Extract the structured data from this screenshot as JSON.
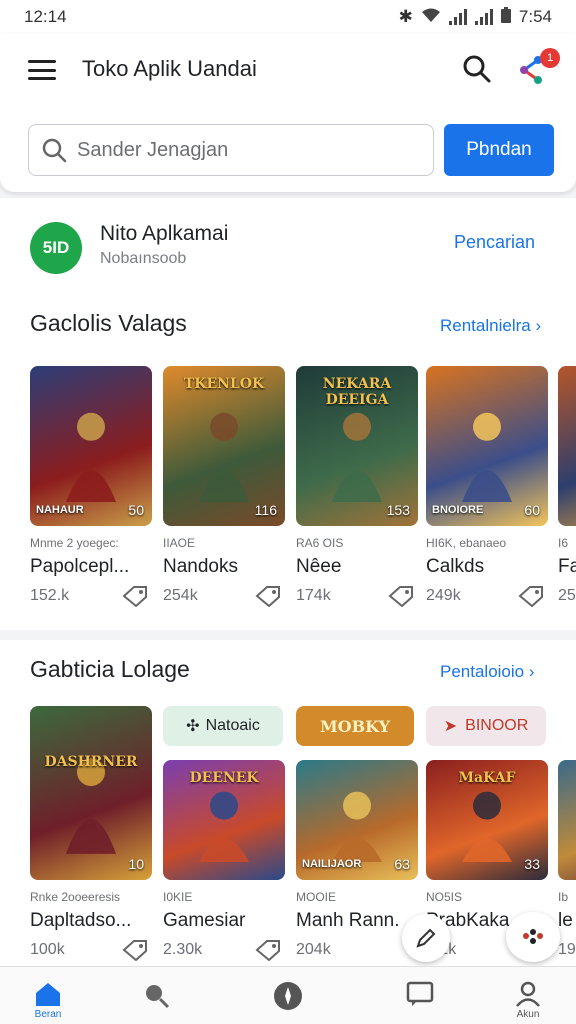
{
  "status_bar": {
    "time": "12:14",
    "right_time": "7:54"
  },
  "header": {
    "title": "Toko Aplik Uandai",
    "notification_count": "1",
    "search_placeholder": "Sander Jenagjan",
    "search_button": "Pbndan"
  },
  "promo": {
    "logo_text": "5ID",
    "title": "Nito Aplkamai",
    "subtitle": "Nobaınsoob",
    "link": "Pencarian"
  },
  "section1": {
    "title": "Gaclolis Valags",
    "link": "Rentalnielra ›",
    "cards": [
      {
        "thumb_label": "NAHAUR",
        "thumb_num": "50",
        "dev": "Mnme 2 yoegec:",
        "name": "Papolcepl...",
        "size": "152.k",
        "colors": [
          "#2c3e78",
          "#8c1d1d",
          "#c9a04a"
        ]
      },
      {
        "thumb_title": "TKENLOK",
        "thumb_num": "116",
        "dev": "IIAOE",
        "name": "Nandoks",
        "size": "254k",
        "colors": [
          "#e08a2c",
          "#3d5a3a",
          "#7a4a2a"
        ]
      },
      {
        "thumb_title": "NEKARA DEEIGA",
        "thumb_num": "153",
        "dev": "RA6 OIS",
        "name": "Nêee",
        "size": "174k",
        "colors": [
          "#1f3b3a",
          "#3f6b4a",
          "#a2733a"
        ]
      },
      {
        "thumb_label": "BNOIORE",
        "thumb_num": "60",
        "dev": "HI6K, ebanaeo",
        "name": "Calkds",
        "size": "249k",
        "colors": [
          "#d9731f",
          "#3b4e8a",
          "#f3c45a"
        ]
      },
      {
        "dev": "I6",
        "name": "Fa",
        "size": "25",
        "colors": [
          "#b5562a",
          "#2d3e6e",
          "#e0a040"
        ]
      }
    ]
  },
  "section2": {
    "title": "Gabticia Lolage",
    "link": "Pentaloioio ›",
    "pills": [
      "Natoaic",
      "MOBKY",
      "BINOOR"
    ],
    "cards": [
      {
        "thumb_title": "DASHRNER",
        "thumb_num": "10",
        "dev": "Rnke 2ooeeresis",
        "name": "Dapltadso...",
        "size": "100k",
        "colors": [
          "#3b6a3c",
          "#6f1f2a",
          "#d6a23a"
        ]
      },
      {
        "thumb_title": "DEENEK",
        "dev": "I0KIE",
        "name": "Gamesiar",
        "size": "2.30k",
        "colors": [
          "#7a3fb0",
          "#c94a2a",
          "#2a4a8a"
        ]
      },
      {
        "thumb_label": "NAILIJAOR",
        "thumb_num": "63",
        "dev": "MOOIE",
        "name": "Manh Rann.",
        "size": "204k",
        "colors": [
          "#2a7a8a",
          "#b86a2a",
          "#e8c05a"
        ]
      },
      {
        "thumb_title": "MaKAF",
        "thumb_num": "33",
        "dev": "NO5IS",
        "name": "PrabKaka",
        "size": "2.2k",
        "colors": [
          "#8a1f1f",
          "#e0662a",
          "#2b2b3b"
        ]
      },
      {
        "dev": "Ib",
        "name": "le",
        "size": "19",
        "colors": [
          "#3a6a8a",
          "#c08a3a",
          "#5a2a3a"
        ]
      }
    ]
  },
  "bottom_nav": {
    "home_label": "Beran",
    "profile_label": "Akun"
  },
  "colors": {
    "accent": "#1a73e8",
    "promo_green": "#1fa64a",
    "badge": "#e53935"
  }
}
